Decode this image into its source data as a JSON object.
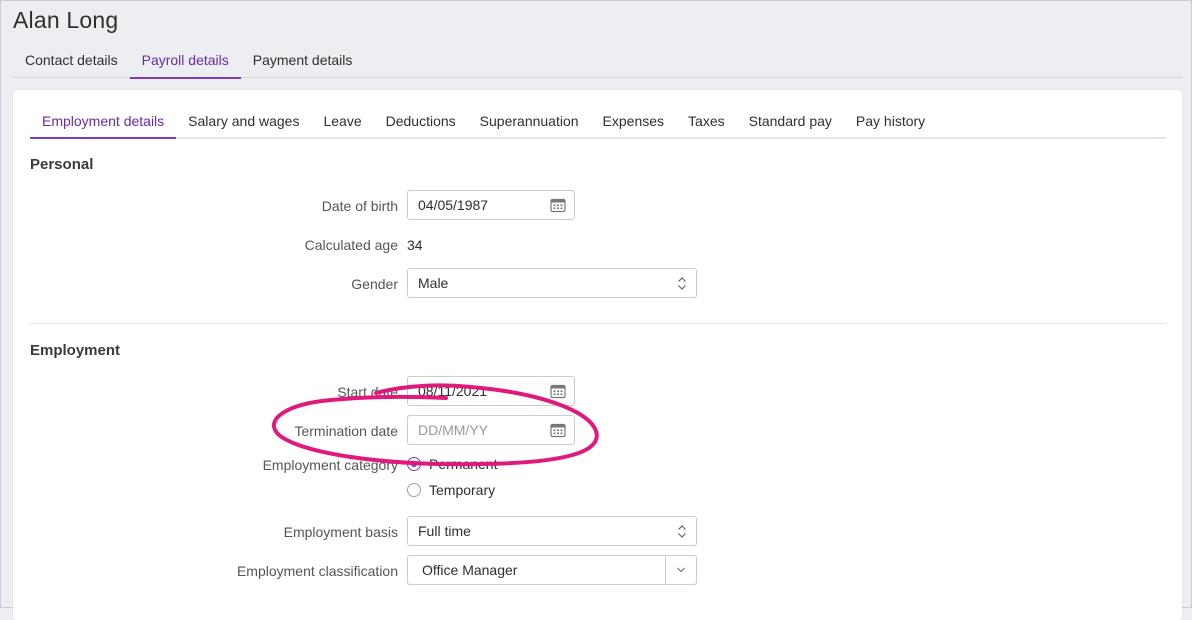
{
  "page": {
    "title": "Alan Long"
  },
  "top_tabs": [
    {
      "label": "Contact details",
      "active": false
    },
    {
      "label": "Payroll details",
      "active": true
    },
    {
      "label": "Payment details",
      "active": false
    }
  ],
  "sub_tabs": [
    {
      "label": "Employment details",
      "active": true
    },
    {
      "label": "Salary and wages",
      "active": false
    },
    {
      "label": "Leave",
      "active": false
    },
    {
      "label": "Deductions",
      "active": false
    },
    {
      "label": "Superannuation",
      "active": false
    },
    {
      "label": "Expenses",
      "active": false
    },
    {
      "label": "Taxes",
      "active": false
    },
    {
      "label": "Standard pay",
      "active": false
    },
    {
      "label": "Pay history",
      "active": false
    }
  ],
  "personal": {
    "title": "Personal",
    "dob_label": "Date of birth",
    "dob_value": "04/05/1987",
    "age_label": "Calculated age",
    "age_value": "34",
    "gender_label": "Gender",
    "gender_value": "Male"
  },
  "employment": {
    "title": "Employment",
    "start_label": "Start date",
    "start_value": "08/11/2021",
    "termination_label": "Termination date",
    "termination_placeholder": "DD/MM/YY",
    "category_label": "Employment category",
    "category_options": [
      "Permanent",
      "Temporary"
    ],
    "category_selected": "Permanent",
    "basis_label": "Employment basis",
    "basis_value": "Full time",
    "classification_label": "Employment classification",
    "classification_value": "Office Manager"
  },
  "colors": {
    "accent": "#7c3cc4",
    "annotation": "#e0197d"
  },
  "icons": {
    "calendar": "calendar-icon",
    "select": "updown-chevron-icon",
    "combo": "chevron-down-icon"
  }
}
